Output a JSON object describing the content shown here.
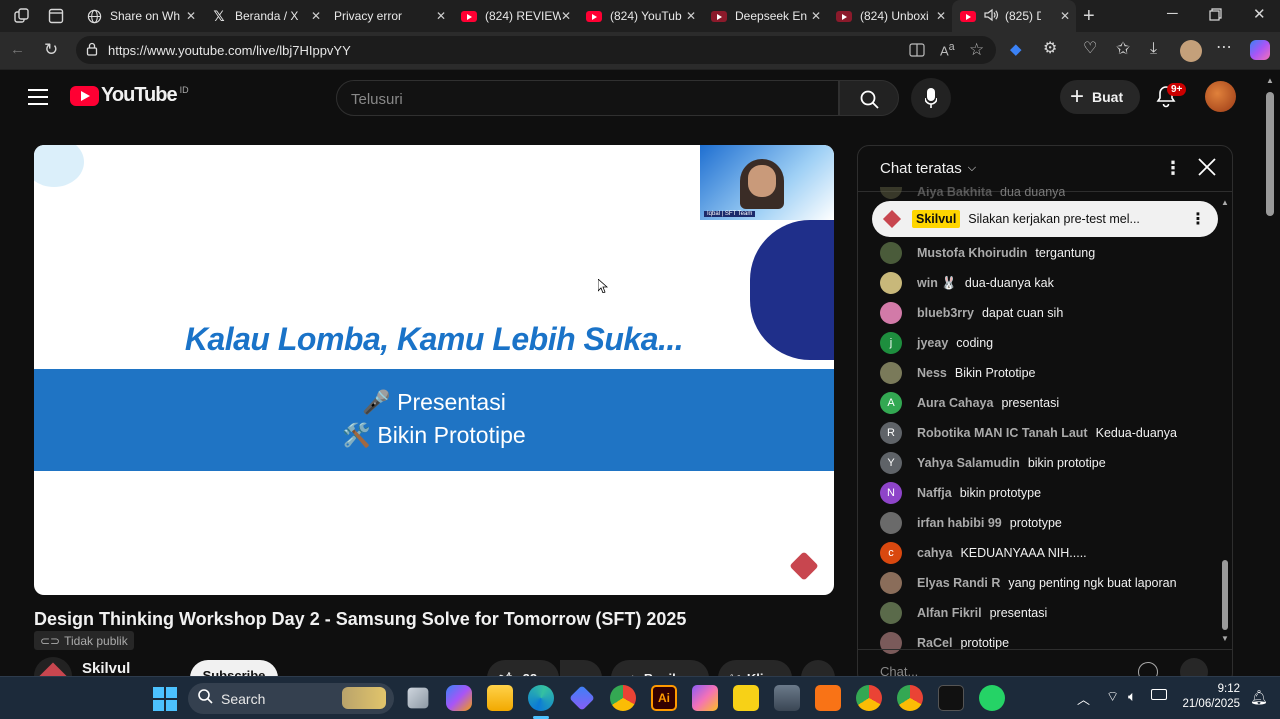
{
  "browser": {
    "tabs": [
      {
        "title": "Share on Wh",
        "icon": "globe-icon"
      },
      {
        "title": "Beranda / X",
        "icon": "x-logo-icon"
      },
      {
        "title": "Privacy error",
        "icon": "warning-icon"
      },
      {
        "title": "(824) REVIEW",
        "icon": "youtube-icon"
      },
      {
        "title": "(824) YouTub",
        "icon": "youtube-icon"
      },
      {
        "title": "Deepseek En",
        "icon": "youtube-icon"
      },
      {
        "title": "(824) Unboxi",
        "icon": "youtube-icon"
      },
      {
        "title": "(825) De",
        "icon": "youtube-icon"
      }
    ],
    "url": "https://www.youtube.com/live/lbj7HIppvYY"
  },
  "youtube": {
    "logo_text": "YouTube",
    "country_code": "ID",
    "search_placeholder": "Telusuri",
    "create_label": "Buat",
    "notif_badge": "9+",
    "video": {
      "slide_title": "Kalau Lomba, Kamu Lebih Suka...",
      "option1": "🎤 Presentasi",
      "option2": "🛠️ Bikin Prototipe",
      "webcam_caption": "Iqbal | SFT Team"
    },
    "title": "Design Thinking Workshop Day 2 - Samsung Solve for Tomorrow (SFT) 2025",
    "visibility": "Tidak publik",
    "channel": "Skilvul",
    "subscribe_label": "Subscribe",
    "likes": "22",
    "share_label": "Bagikan",
    "clip_label": "Klip"
  },
  "chat": {
    "header": "Chat teratas",
    "pinned": {
      "author": "Skilvul",
      "text": "Silakan kerjakan pre-test mel..."
    },
    "partial_top": {
      "author": "Aiya Bakhita",
      "text": "dua duanya"
    },
    "messages": [
      {
        "author": "Mustofa Khoirudin",
        "text": "tergantung",
        "avatar": "",
        "color": "#4a5b3a"
      },
      {
        "author": "win 🐰",
        "text": "dua-duanya kak",
        "avatar": "",
        "color": "#c8b87a"
      },
      {
        "author": "blueb3rry",
        "text": "dapat cuan sih",
        "avatar": "",
        "color": "#d27aa8"
      },
      {
        "author": "jyeay",
        "text": "coding",
        "avatar": "j",
        "color": "#1e8e3e"
      },
      {
        "author": "Ness",
        "text": "Bikin Prototipe",
        "avatar": "",
        "color": "#7a7a5a"
      },
      {
        "author": "Aura Cahaya",
        "text": "presentasi",
        "avatar": "A",
        "color": "#33a852"
      },
      {
        "author": "Robotika MAN IC Tanah Laut",
        "text": "Kedua-duanya",
        "avatar": "R",
        "color": "#5f6368"
      },
      {
        "author": "Yahya Salamudin",
        "text": "bikin prototipe",
        "avatar": "Y",
        "color": "#5f6368"
      },
      {
        "author": "Naffja",
        "text": "bikin prototype",
        "avatar": "N",
        "color": "#8e44c9"
      },
      {
        "author": "irfan habibi 99",
        "text": "prototype",
        "avatar": "",
        "color": "#6a6a6a"
      },
      {
        "author": "cahya",
        "text": "KEDUANYAAA NIH.....",
        "avatar": "c",
        "color": "#d9480f"
      },
      {
        "author": "Elyas Randi R",
        "text": "yang penting ngk buat laporan",
        "avatar": "",
        "color": "#8a6d5a"
      },
      {
        "author": "Alfan Fikril",
        "text": "presentasi",
        "avatar": "",
        "color": "#5a6a4a"
      },
      {
        "author": "RaCel",
        "text": "prototipe",
        "avatar": "",
        "color": "#7a5a5a"
      }
    ],
    "input_placeholder": "Chat..."
  },
  "taskbar": {
    "search_label": "Search",
    "time": "9:12",
    "date": "21/06/2025"
  }
}
